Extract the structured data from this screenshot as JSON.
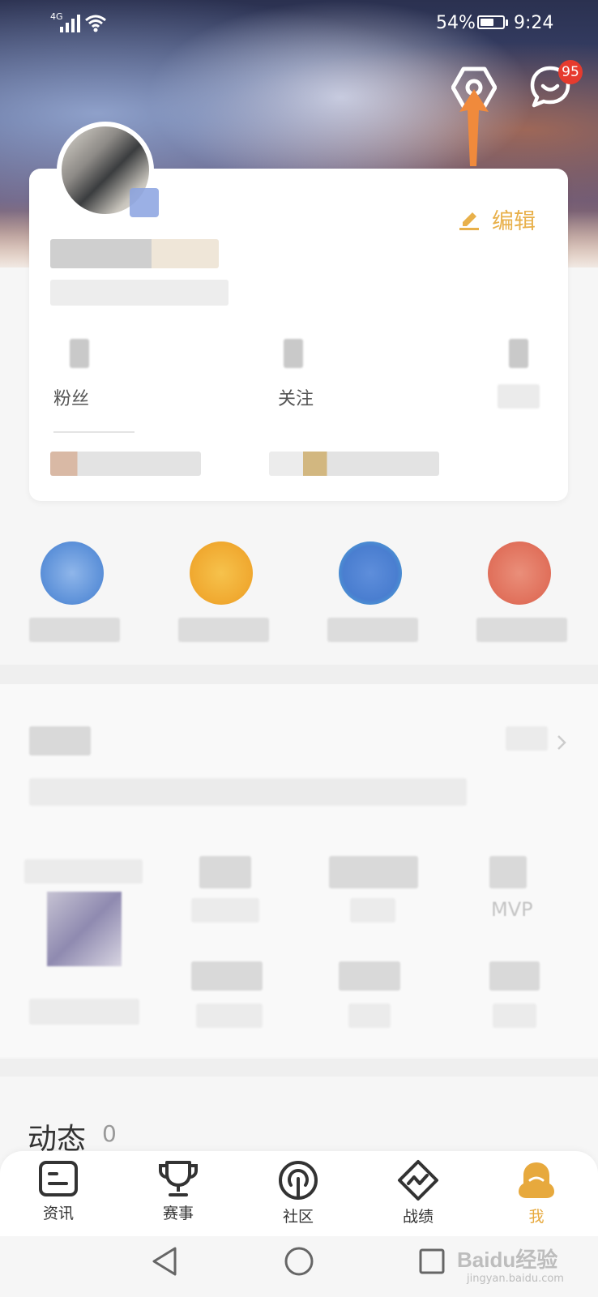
{
  "status_bar": {
    "network": "4G",
    "battery": "54%",
    "time": "9:24"
  },
  "header": {
    "message_badge": "95"
  },
  "profile": {
    "edit_label": "编辑",
    "stats": [
      {
        "label": "粉丝"
      },
      {
        "label": "关注"
      },
      {
        "label": ""
      }
    ]
  },
  "record": {
    "mvp_label": "MVP"
  },
  "feed": {
    "title": "动态",
    "count": "0"
  },
  "tabs": [
    {
      "label": "资讯",
      "icon": "news-icon"
    },
    {
      "label": "赛事",
      "icon": "trophy-icon"
    },
    {
      "label": "社区",
      "icon": "community-icon"
    },
    {
      "label": "战绩",
      "icon": "stats-icon"
    },
    {
      "label": "我",
      "icon": "me-icon"
    }
  ],
  "watermark": {
    "brand": "Baidu经验",
    "url": "jingyan.baidu.com"
  },
  "colors": {
    "accent": "#e7a93d",
    "badge": "#e63b2e",
    "arrow": "#f08a3c"
  }
}
